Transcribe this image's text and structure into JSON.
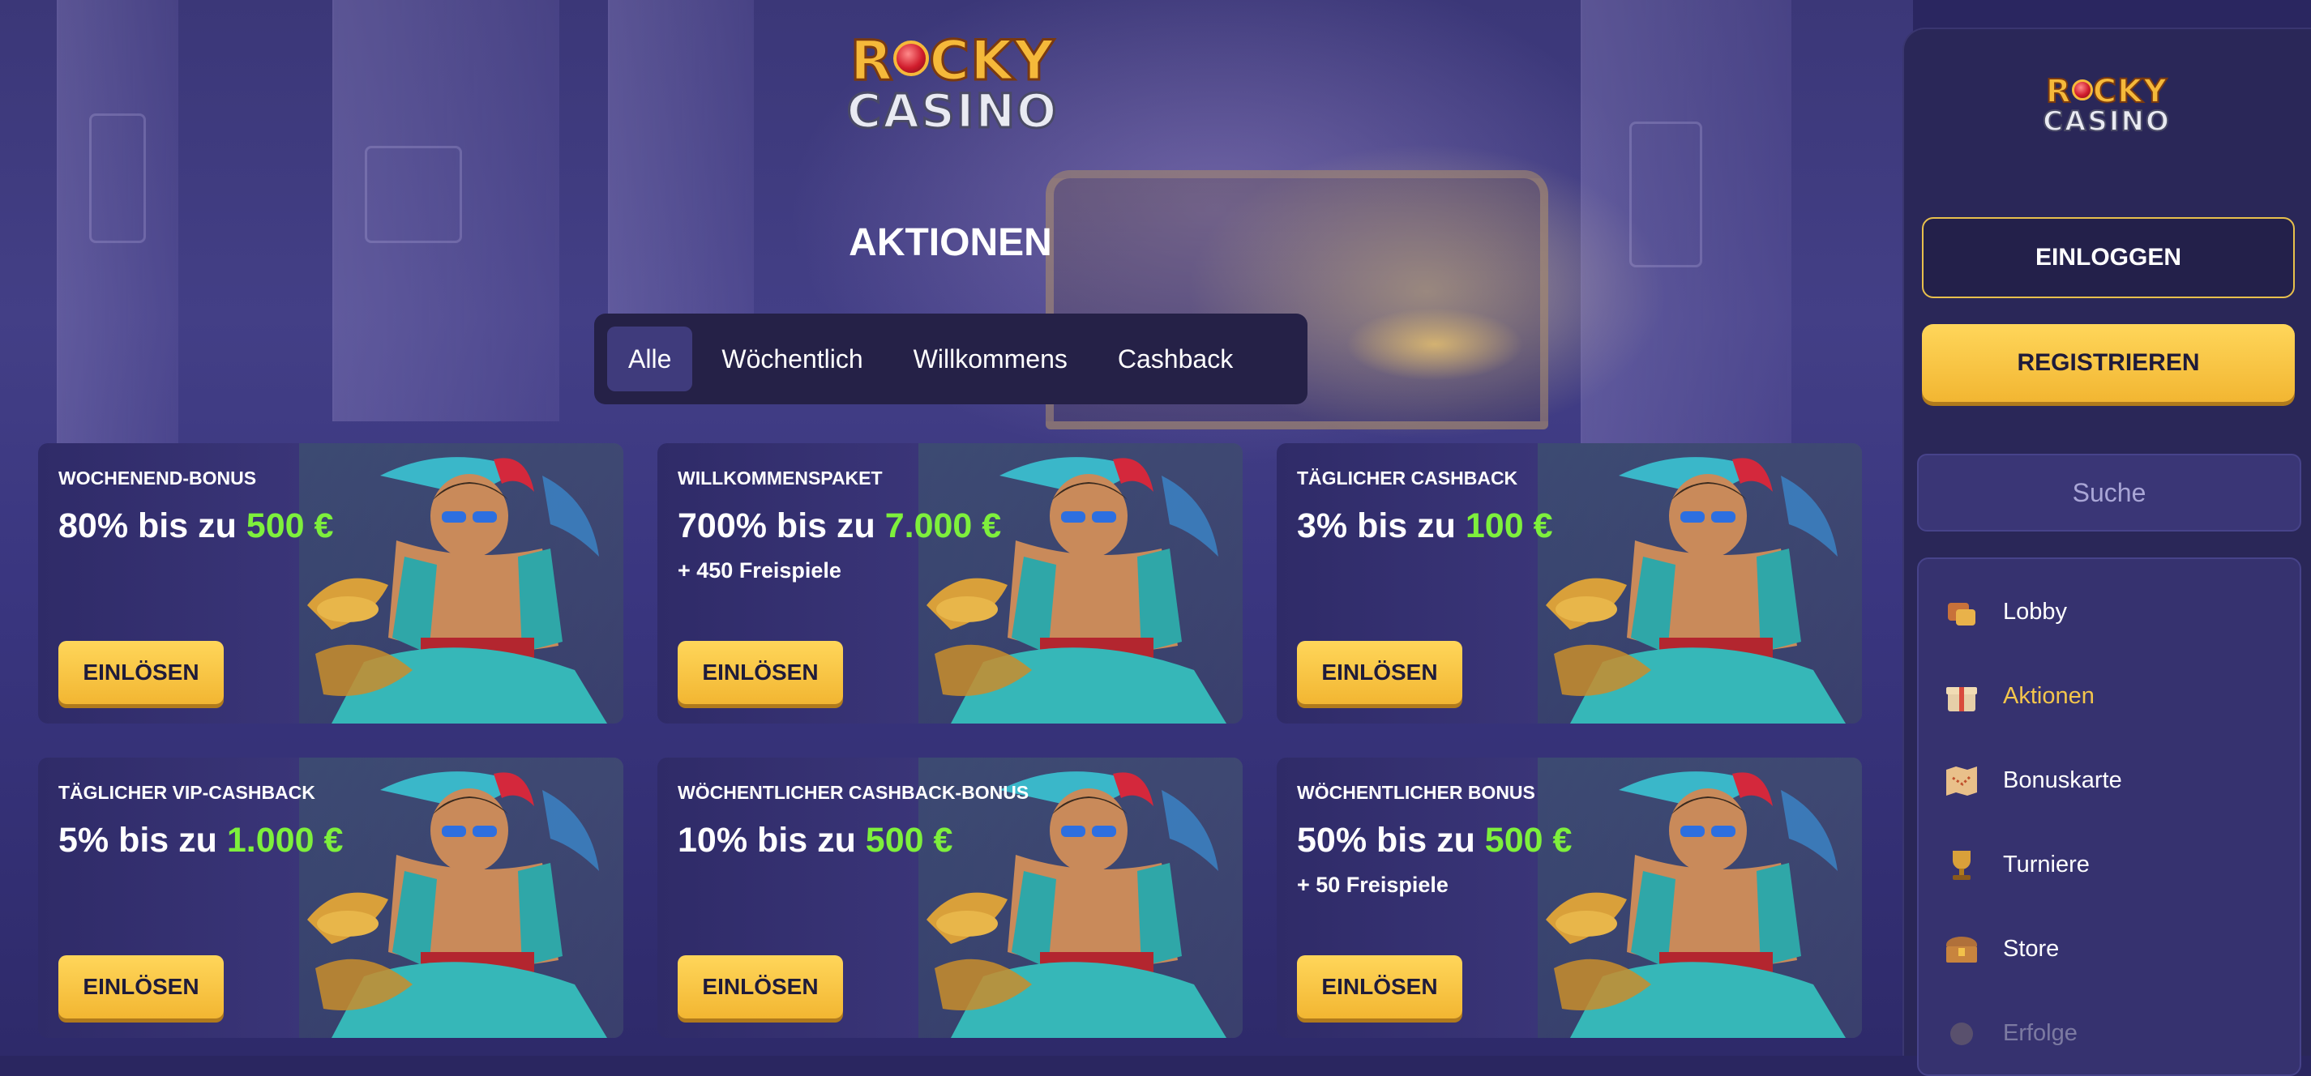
{
  "brand": {
    "logo_top": "ROCKY",
    "logo_bottom": "CASINO"
  },
  "page": {
    "title": "AKTIONEN"
  },
  "filters": [
    {
      "label": "Alle",
      "active": true
    },
    {
      "label": "Wöchentlich",
      "active": false
    },
    {
      "label": "Willkommens",
      "active": false
    },
    {
      "label": "Cashback",
      "active": false
    }
  ],
  "cards": [
    {
      "label": "WOCHENEND-BONUS",
      "offer_prefix": "80% bis zu ",
      "offer_amount": "500 €",
      "extra": "",
      "button": "EINLÖSEN"
    },
    {
      "label": "WILLKOMMENSPAKET",
      "offer_prefix": "700% bis zu ",
      "offer_amount": "7.000 €",
      "extra": "+ 450 Freispiele",
      "button": "EINLÖSEN"
    },
    {
      "label": "TÄGLICHER CASHBACK",
      "offer_prefix": "3% bis zu ",
      "offer_amount": "100 €",
      "extra": "",
      "button": "EINLÖSEN"
    },
    {
      "label": "TÄGLICHER VIP-CASHBACK",
      "offer_prefix": "5% bis zu ",
      "offer_amount": "1.000 €",
      "extra": "",
      "button": "EINLÖSEN"
    },
    {
      "label": "WÖCHENTLICHER CASHBACK-BONUS",
      "offer_prefix": "10% bis zu ",
      "offer_amount": "500 €",
      "extra": "",
      "button": "EINLÖSEN"
    },
    {
      "label": "WÖCHENTLICHER BONUS",
      "offer_prefix": "50% bis zu ",
      "offer_amount": "500 €",
      "extra": "+ 50 Freispiele",
      "button": "EINLÖSEN"
    }
  ],
  "sidebar": {
    "login_label": "EINLOGGEN",
    "register_label": "REGISTRIEREN",
    "search_placeholder": "Suche",
    "nav": [
      {
        "label": "Lobby",
        "icon": "lobby-icon",
        "active": false
      },
      {
        "label": "Aktionen",
        "icon": "gift-icon",
        "active": true
      },
      {
        "label": "Bonuskarte",
        "icon": "map-icon",
        "active": false
      },
      {
        "label": "Turniere",
        "icon": "trophy-icon",
        "active": false
      },
      {
        "label": "Store",
        "icon": "chest-icon",
        "active": false
      },
      {
        "label": "Erfolge",
        "icon": "medal-icon",
        "active": false
      }
    ]
  },
  "colors": {
    "accent_gold": "#f4c64c",
    "highlight_green": "#7ef03c",
    "panel": "#2a2758"
  }
}
